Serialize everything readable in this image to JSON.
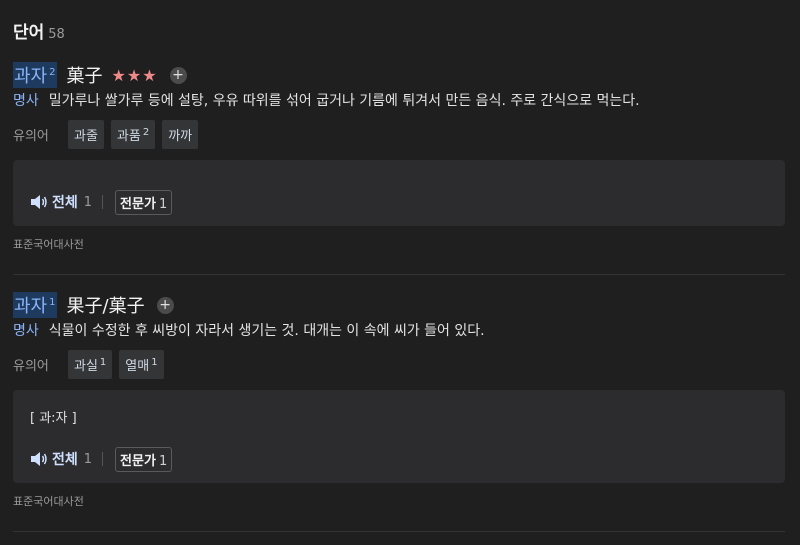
{
  "section": {
    "title": "단어",
    "count": "58"
  },
  "entries": [
    {
      "word": "과자",
      "sup": "2",
      "hanja": "菓子",
      "stars": "★★★",
      "plus": "+",
      "pos": "명사",
      "definition": "밀가루나 쌀가루 등에 설탕, 우유 따위를 섞어 굽거나 기름에 튀겨서 만든 음식. 주로 간식으로 먹는다.",
      "syn_label": "유의어",
      "synonyms": [
        {
          "text": "과줄",
          "sup": ""
        },
        {
          "text": "과품",
          "sup": "2"
        },
        {
          "text": "까까",
          "sup": ""
        }
      ],
      "pron_text": "",
      "audio_all": {
        "label": "전체",
        "count": "1"
      },
      "audio_expert": {
        "label": "전문가",
        "count": "1"
      },
      "source": "표준국어대사전"
    },
    {
      "word": "과자",
      "sup": "1",
      "hanja": "果子/菓子",
      "stars": "",
      "plus": "+",
      "pos": "명사",
      "definition": "식물이 수정한 후 씨방이 자라서 생기는 것. 대개는 이 속에 씨가 들어 있다.",
      "syn_label": "유의어",
      "synonyms": [
        {
          "text": "과실",
          "sup": "1"
        },
        {
          "text": "열매",
          "sup": "1"
        }
      ],
      "pron_text": "[ 과:자 ]",
      "audio_all": {
        "label": "전체",
        "count": "1"
      },
      "audio_expert": {
        "label": "전문가",
        "count": "1"
      },
      "source": "표준국어대사전"
    }
  ],
  "colors": {
    "background": "#1f1f1f",
    "accent": "#8ab4f8",
    "star": "#f08a8a",
    "box": "#2c2c2e"
  }
}
